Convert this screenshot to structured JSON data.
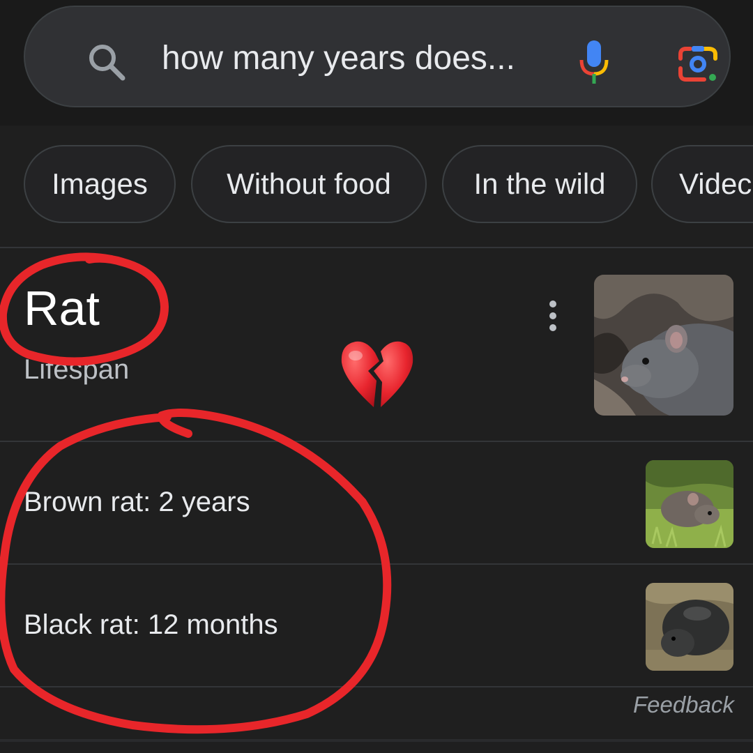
{
  "search": {
    "query": "how many years does...",
    "icons": {
      "search": "search-icon",
      "mic": "mic-icon",
      "lens": "google-lens-icon"
    }
  },
  "chips": [
    {
      "label": "Images"
    },
    {
      "label": "Without food"
    },
    {
      "label": "In the wild"
    },
    {
      "label": "Videc"
    }
  ],
  "result": {
    "title": "Rat",
    "subtitle": "Lifespan",
    "emoji": "broken-heart-emoji",
    "rows": [
      {
        "label": "Brown rat: 2 years"
      },
      {
        "label": "Black rat: 12 months"
      }
    ],
    "feedback": "Feedback"
  },
  "colors": {
    "background": "#1f1f1f",
    "search_bg": "#303134",
    "annotation_red": "#e8262a",
    "text_primary": "#e8eaed",
    "text_secondary": "#bdc1c6"
  }
}
